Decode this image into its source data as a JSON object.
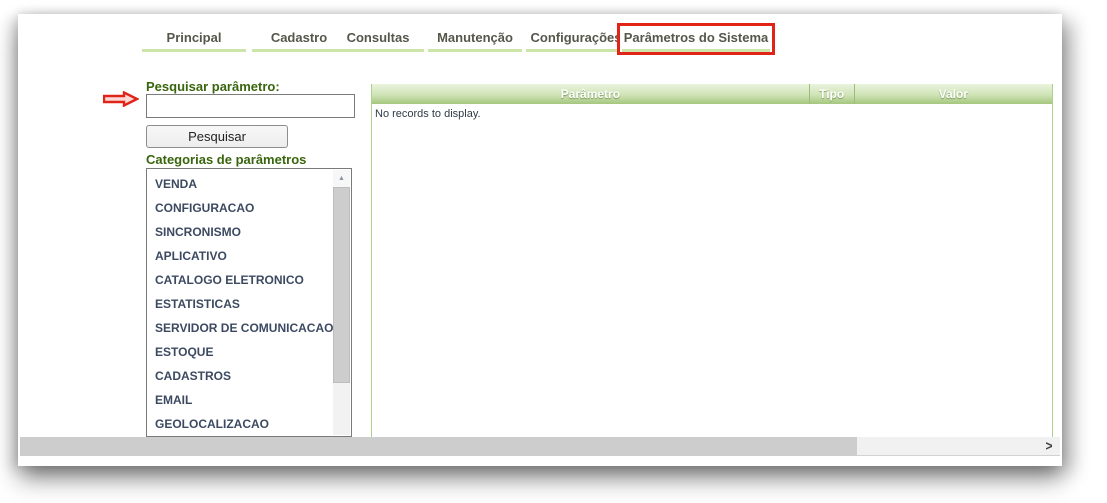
{
  "tabs": {
    "items": [
      {
        "label": "Principal",
        "highlighted": false
      },
      {
        "label": "Cadastro",
        "highlighted": false
      },
      {
        "label": "Consultas",
        "highlighted": false
      },
      {
        "label": "Manutenção",
        "highlighted": false
      },
      {
        "label": "Configurações",
        "highlighted": false
      },
      {
        "label": "Parâmetros do Sistema",
        "highlighted": true
      }
    ]
  },
  "search_panel": {
    "label": "Pesquisar parâmetro:",
    "input_value": "",
    "input_placeholder": "",
    "button_label": "Pesquisar"
  },
  "categories_panel": {
    "title": "Categorias de parâmetros",
    "items": [
      "VENDA",
      "CONFIGURACAO",
      "SINCRONISMO",
      "APLICATIVO",
      "CATALOGO ELETRONICO",
      "ESTATISTICAS",
      "SERVIDOR DE COMUNICACAO",
      "ESTOQUE",
      "CADASTROS",
      "EMAIL",
      "GEOLOCALIZACAO"
    ]
  },
  "table": {
    "columns": [
      {
        "label": "Parâmetro"
      },
      {
        "label": "Tipo"
      },
      {
        "label": "Valor"
      }
    ],
    "empty_message": "No records to display."
  },
  "icons": {
    "scroll_up_glyph": "▲",
    "scroll_right_glyph": ">",
    "annotation_arrow": "red-arrow-right"
  },
  "colors": {
    "tab_underline_green": "#cde5aa",
    "tab_text": "#56564b",
    "label_green": "#39650d",
    "list_text": "#3c4a61",
    "header_green_top": "#eaf4de",
    "header_green_bottom": "#a4c67e",
    "table_border_green": "#aed08d",
    "highlight_red": "#e02418",
    "scrollbar_thumb": "#cdcdcd"
  }
}
